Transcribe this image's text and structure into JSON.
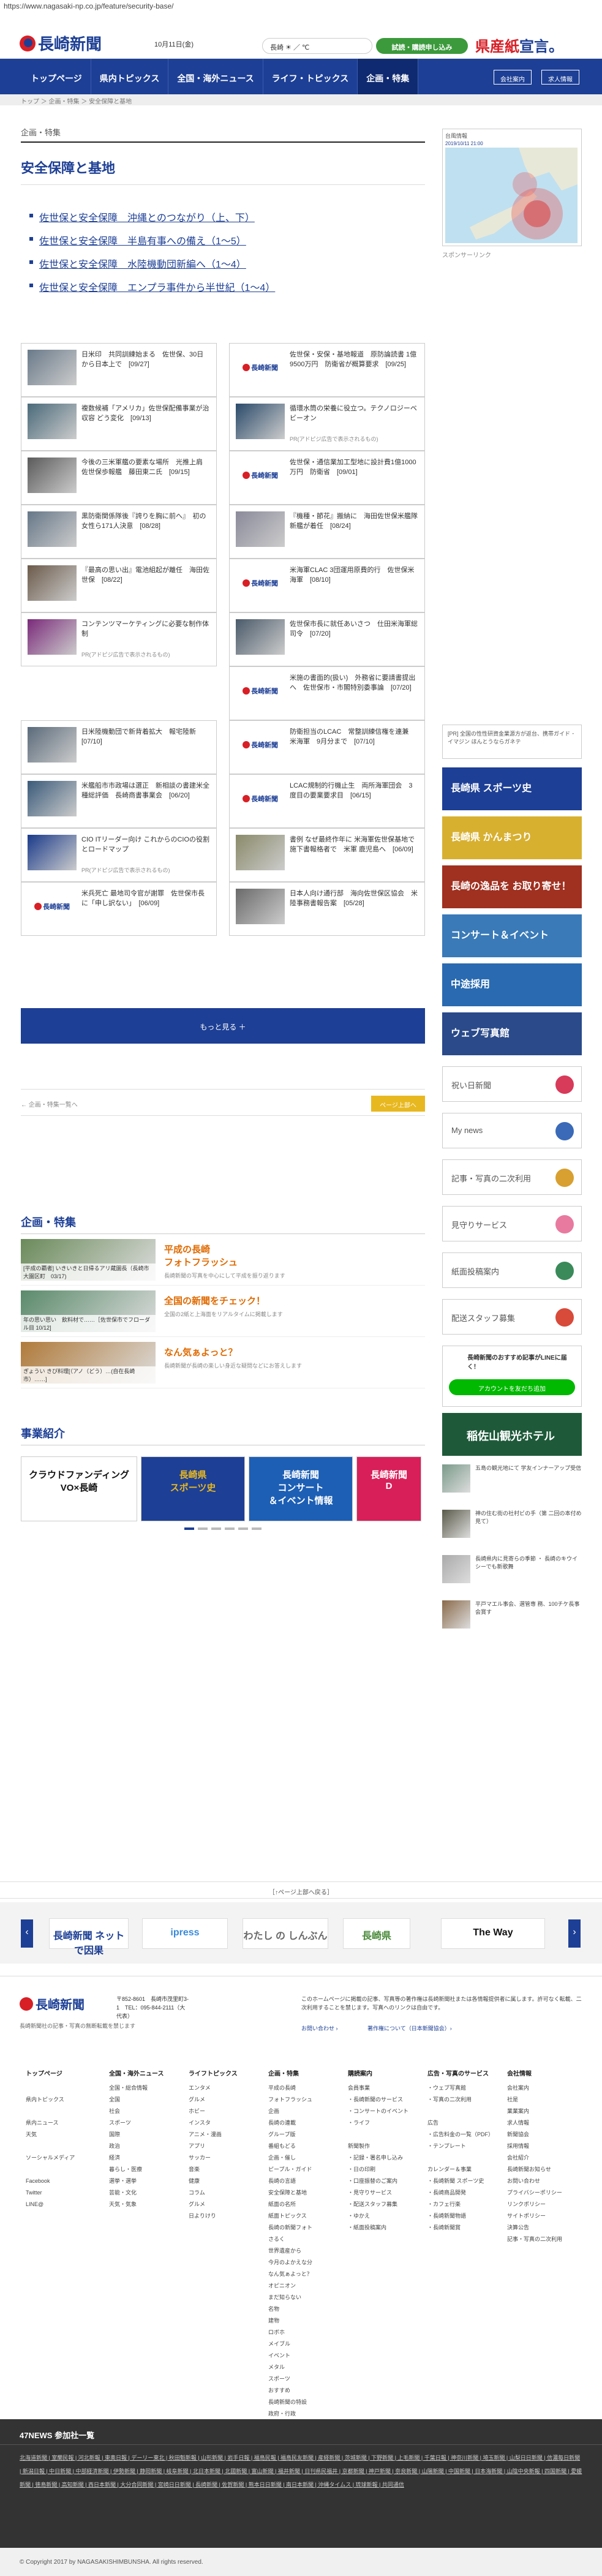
{
  "browser": {
    "url": "https://www.nagasaki-np.co.jp/feature/security-base/"
  },
  "header": {
    "logo": "長崎新聞",
    "date": "10月11日(金)",
    "weather": "長崎 ☀ ／ ℃",
    "trial": "試読・購読申し込み",
    "slogan_a": "県産",
    "slogan_b": "紙",
    "slogan_c": "宣言。"
  },
  "nav": {
    "items": [
      "トップページ",
      "県内トピックス",
      "全国・海外ニュース",
      "ライフ・トピックス",
      "企画・特集"
    ],
    "r1": "会社案内",
    "r2": "求人情報"
  },
  "breadcrumb": "トップ ＞ 企画・特集 ＞ 安全保障と基地",
  "section_label": "企画・特集",
  "page_title": "安全保障と基地",
  "top_links": [
    "佐世保と安全保障　沖縄とのつながり（上、下）",
    "佐世保と安全保障　半島有事への備え（1～5）",
    "佐世保と安全保障　水陸機動団新編へ（1～4）",
    "佐世保と安全保障　エンプラ事件から半世紀（1～4）"
  ],
  "cards": [
    {
      "t": "日米印　共同訓練始まる　佐世保、30日から日本上で　[09/27]",
      "c": "#6a7a8a"
    },
    {
      "t": "佐世保・安保・基地報道　原防論読書 1億9500万円　防衛省が概算要求　[09/25]",
      "c": "logo"
    },
    {
      "t": "複数候補「アメリカ」佐世保配備事業が治収容 どう変化　[09/13]",
      "c": "#4a6a7a"
    },
    {
      "t": "循環水筒の栄養に役立つ。テクノロジーベビーオン",
      "c": "#2a4a6a",
      "pr": "PR(アドピジ広告で表示されるもの)"
    },
    {
      "t": "今後の三米軍艦の要素な場所　光推上肩　佐世保歩報艦　藤田東二氏　[09/15]",
      "c": "#5a5a5a"
    },
    {
      "t": "佐世保・通信業加工型地に設計費1億1000万円　防衛省　[09/01]",
      "c": "logo"
    },
    {
      "t": "黒防衛関係隊後『誇りを胸に前へ』　初の女性ら171人決意　[08/28]",
      "c": "#667788"
    },
    {
      "t": "『機種・節花』搬納に　海田佐世保米艦隊新艦が着任　[08/24]",
      "c": "#8a8a9a"
    },
    {
      "t": "『最高の思い出』電池組起が離任　海田佐世保　[08/22]",
      "c": "#6b5a4a"
    },
    {
      "t": "米海軍CLAC 3団運用原費的行　佐世保米海軍　[08/10]",
      "c": "logo"
    },
    {
      "t": "コンテンツマーケティングに必要な制作体制",
      "c": "#7a2a7a",
      "pr": "PR(アドピジ広告で表示されるもの)"
    },
    {
      "t": "佐世保市長に就任あいさつ　仕田米海軍総司令　[07/20]",
      "c": "#4a5a6a"
    },
    {
      "t": "",
      "c": "none"
    },
    {
      "t": "米施の書面的(扱い)　外務省に要請書提出へ　佐世保市・市閣特別委事論　[07/20]",
      "c": "logo"
    },
    {
      "t": "日米陸機動団で新背着拡大　報宅陸新　[07/10]",
      "c": "#5a6a7a"
    },
    {
      "t": "防衛担当のLCAC　常整訓練信権を連兼　米海軍　9月分まで　[07/10]",
      "c": "logo"
    },
    {
      "t": "米艦船市市政場は選正　新相談の書建米全種総評価　長崎商書事業会　[06/20]",
      "c": "#3a5a7a"
    },
    {
      "t": "LCAC規制的行機止生　両所海軍団会　3度目の要業要求目　[06/15]",
      "c": "logo"
    },
    {
      "t": "CIO ITリーダー向け これからのCIOの役割とロードマップ",
      "c": "#1a3a8a",
      "pr": "PR(アドピジ広告で表示されるもの)"
    },
    {
      "t": "書例 なぜ最終作年に 米海軍佐世保基地で施下書報格者で　米軍 鹿児島へ　[06/09]",
      "c": "#8a8a6a"
    },
    {
      "t": "米兵死亡 最地司令官が謝罪　佐世保市長に「申し訳ない」　[06/09]",
      "c": "logo"
    },
    {
      "t": "日本人向け通行部　海向佐世保区協会　米陸事務書報告案　[05/28]",
      "c": "#6a6a6a"
    }
  ],
  "more_button": "もっと見る ＋",
  "pager": {
    "prev": "← 企画・特集一覧へ",
    "next": "ページ上部へ"
  },
  "features_heading": "企画・特集",
  "features": [
    {
      "cap": "[平成の覇者] いきいきと日帰るアリ蔵園長（長崎市大園区町　03/17)",
      "title": "平成の長崎\nフォトフラッシュ",
      "desc": "長崎新聞の写真を中心にして平成を振り返ります",
      "c": "#6a8a5a"
    },
    {
      "cap": "年の思い思い　飲料材で……［佐世保市でフローダル目 10/12]",
      "title": "全国の新聞をチェック！",
      "desc": "全国の2紙と上海面をリアルタイムに掲載します",
      "c": "#5a8a6a"
    },
    {
      "cap": "ぎょうい きび料理[（アノ（どう）…(自在長崎市）……]",
      "title": "なん気ぁよっと？",
      "desc": "長崎新聞が長崎の楽しい身近な疑問などにお答えします",
      "c": "#b07a3a"
    }
  ],
  "biz_heading": "事業紹介",
  "biz": [
    {
      "t": "クラウドファンディング\nVO×長崎",
      "c": "#ffffff",
      "fg": "#111"
    },
    {
      "t": "長崎県\nスポーツ史",
      "c": "#1d3f95",
      "fg": "#e8b820"
    },
    {
      "t": "長崎新聞\nコンサート\n＆イベント情報",
      "c": "#1d5fb5",
      "fg": "#fff"
    },
    {
      "t": "長崎新聞\nD",
      "c": "#d81f5a",
      "fg": "#fff"
    }
  ],
  "sidebar": {
    "map_label": "台風情報",
    "map_date": "2019/10/11 21:00",
    "sponsor": "スポンサーリンク",
    "ad_text": "[PR] 全国の性性研資金業源方が返台、携帯ガイド ･ イマジン ほんとうならガネテ",
    "banners": [
      {
        "t": "長崎県 スポーツ史",
        "c": "#1d3f95"
      },
      {
        "t": "長崎県 かんまつり",
        "c": "#d8b030"
      },
      {
        "t": "長崎の逸品を お取り寄せ！",
        "c": "#a03020"
      },
      {
        "t": "コンサート＆イベント",
        "c": "#3a7ab8"
      },
      {
        "t": "中途採用",
        "c": "#2a6ab0"
      },
      {
        "t": "ウェブ写真館",
        "c": "#2a4a8a"
      }
    ],
    "buttons": [
      {
        "t": "祝い日新聞",
        "c": "#d83a5a"
      },
      {
        "t": "My news",
        "c": "#3a6ab8"
      },
      {
        "t": "記事・写真の二次利用",
        "c": "#d8a030"
      },
      {
        "t": "見守りサービス",
        "c": "#e87aa0"
      },
      {
        "t": "紙面投稿案内",
        "c": "#3a8a5a"
      },
      {
        "t": "配送スタッフ募集",
        "c": "#d84a3a"
      }
    ],
    "line": {
      "t": "長崎新聞のおすすめ記事がLINEに届く！",
      "b": "アカウントを友だち追加"
    },
    "hotel": "稲佐山観光ホテル",
    "news": [
      {
        "t": "五島の観光地にて 学友インナーアップ受信",
        "c": "#7a9a8a"
      },
      {
        "t": "神の住む街の社村ビの手（第 二回の本付め見て）",
        "c": "#5a5a4a"
      },
      {
        "t": "長崎県内に見寄らの季節 ・ 長崎のキウイシーでも新歌舞",
        "c": "#aaaaaa"
      },
      {
        "t": "平戸マエル事会、選管専 務、100チケ長事会賞す",
        "c": "#8a6a4a"
      }
    ]
  },
  "gotop": "［↑ページ上部へ戻る］",
  "carousel": [
    {
      "t": "長崎新聞 ネットで因果",
      "c": "#1d3f95"
    },
    {
      "t": "ipress",
      "c": "#3a8ad8"
    },
    {
      "t": "わたし の しんぶん",
      "c": "#6a6a6a"
    },
    {
      "t": "長崎県",
      "c": "#4a8a3a"
    },
    {
      "t": "The Way",
      "c": "#111"
    }
  ],
  "footer": {
    "address": "〒852-8601　長崎市茂里町3-1　TEL：095-844-2111（大代表）",
    "note": "長崎新聞社の記事・写真の無断転載を禁じます",
    "links": [
      "お問い合わせ ›",
      "著作権について（日本新聞協会）›"
    ],
    "body": "このホームページに掲載の記事、写真等の著作権は長崎新聞社または各情報提供者に属します。許可なく転載、二次利用することを禁じます。写真へのリンクは自由です。",
    "cols": [
      {
        "h": "トップページ",
        "i": [
          "",
          "県内トピックス",
          "",
          "県内ニュース",
          "天気",
          "",
          "ソーシャルメディア",
          "",
          "Facebook",
          "Twitter",
          "LINE@"
        ]
      },
      {
        "h": "全国・海外ニュース",
        "i": [
          "全国・総合情報",
          "全国",
          "社会",
          "スポーツ",
          "国際",
          "政治",
          "経済",
          "暮らし・医療",
          "選挙・選挙",
          "芸能・文化",
          "天気・気象"
        ]
      },
      {
        "h": "ライフトピックス",
        "i": [
          "エンタメ",
          "グルメ",
          "ホビー",
          "インスタ",
          "アニメ・漫画",
          "アプリ",
          "サッカー",
          "音楽",
          "健康",
          "コラム",
          "グルメ",
          "日よりけり"
        ]
      },
      {
        "h": "企画・特集",
        "i": [
          "平成の長崎",
          "フォトフラッシュ",
          "企画",
          "長崎の連載",
          "グループ版",
          "番組もどる",
          "企画・催し",
          "ピープル・ガイド",
          "長崎の言語",
          "安全保障と基地",
          "紙面の名所",
          "紙面トピックス",
          "長崎の新聞フォト",
          "さるく",
          "世界遺産から",
          "今月のよかえな分",
          "なん気ぁよっと？",
          "オピニオン",
          "まだ知らない",
          "名物",
          "建物",
          "ロボホ",
          "メイブル",
          "イベント",
          "メタル",
          "スポーツ",
          "おすすめ",
          "長崎新聞の特設",
          "政府・行政"
        ]
      },
      {
        "h": "購読案内",
        "i": [
          "会員事業",
          "・長崎新聞のサービス",
          "・コンサートのイベント",
          "・ライフ",
          "",
          "新聞製作",
          "・記録・署名申し込み",
          "・日の印刷",
          "・口座振替のご案内",
          "・見守りサービス",
          "・配送スタッフ募集",
          "・ゆかえ",
          "・紙面投稿案内"
        ]
      },
      {
        "h": "広告・写真のサービス",
        "i": [
          "・ウェブ写真館",
          "・写真の二次利用",
          "",
          "広告",
          "・広告料金の一覧（PDF）",
          "・テンプレート",
          "",
          "カレンダー＆事業",
          "・長崎新聞 スポーツ史",
          "・長崎商品開発",
          "・カフェ行楽",
          "・長崎新聞物語",
          "・長崎新聞賞"
        ]
      },
      {
        "h": "会社情報",
        "i": [
          "会社案内",
          "社是",
          "業業案内",
          "求人情報",
          "新聞協会",
          "採用情報",
          "会社紹介",
          "長崎新聞お知らせ",
          "お問い合わせ",
          "プライバシーポリシー",
          "リンクポリシー",
          "サイトポリシー",
          "決算公告",
          "記事・写真の二次利用"
        ]
      }
    ]
  },
  "n47": {
    "heading": "47NEWS 参加社一覧",
    "links": "北海道新聞 | 室蘭民報 | 河北新報 | 東奥日報 | デーリー東北 | 秋田魁新報 | 山形新聞 | 岩手日報 | 福島民報 | 福島民友新聞 | 産経新聞 | 茨城新聞 | 下野新聞 | 上毛新聞 | 千葉日報 | 神奈川新聞 | 埼玉新聞 | 山梨日日新聞 | 信濃毎日新聞 | 新潟日報 | 中日新聞 | 中部経済新聞 | 伊勢新聞 | 静岡新聞 | 岐阜新聞 | 北日本新聞 | 北國新聞 | 富山新聞 | 福井新聞 | 日刊県民福井 | 京都新聞 | 神戸新聞 | 奈良新聞 | 山陽新聞 | 中国新聞 | 日本海新聞 | 山陰中央新報 | 四国新聞 | 愛媛新聞 | 徳島新聞 | 高知新聞 | 西日本新聞 | 大分合同新聞 | 宮崎日日新聞 | 長崎新聞 | 佐賀新聞 | 熊本日日新聞 | 南日本新聞 | 沖縄タイムス | 琉球新報 | 共同通信"
  },
  "copyright": "© Copyright 2017 by NAGASAKISHIMBUNSHA. All rights reserved."
}
